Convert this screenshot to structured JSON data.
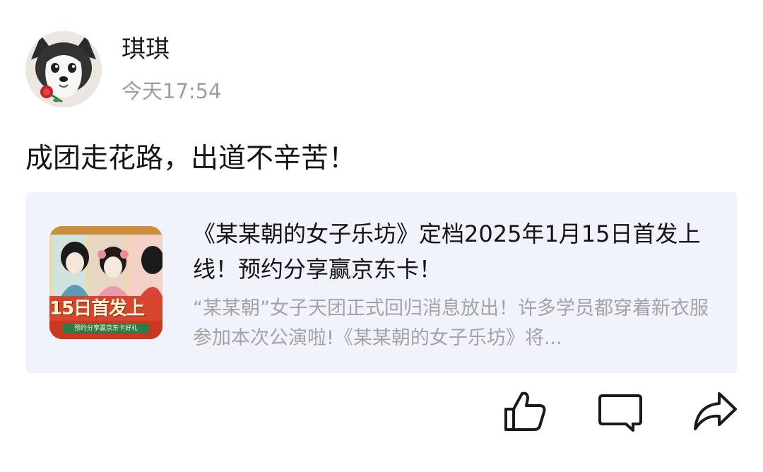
{
  "post": {
    "author": {
      "name": "琪琪",
      "avatar_icon": "husky-dog-with-rose-avatar"
    },
    "timestamp": "今天17:54",
    "text": "成团走花路，出道不辛苦！"
  },
  "share_card": {
    "thumbnail": {
      "icon": "game-app-icon",
      "banner_text": "15日首发上",
      "ribbon_text": "预约分享赢京东卡好礼"
    },
    "title": "《某某朝的女子乐坊》定档2025年1月15日首发上线！预约分享赢京东卡！",
    "description": "“某某朝”女子天团正式回归消息放出！许多学员都穿着新衣服参加本次公演啦!《某某朝的女子乐坊》将..."
  },
  "actions": {
    "like_icon": "thumbs-up-icon",
    "comment_icon": "comment-bubble-icon",
    "share_icon": "share-arrow-icon"
  },
  "colors": {
    "card_background": "#f0f3fb",
    "secondary_text": "#9e9e9e",
    "primary_text": "#141414"
  }
}
